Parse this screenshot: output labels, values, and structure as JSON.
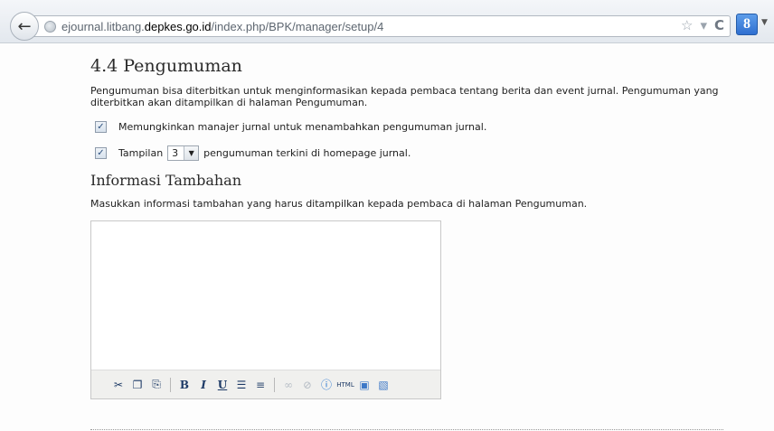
{
  "browser": {
    "url_prefix": "ejournal.litbang.",
    "url_domain": "depkes.go.id",
    "url_path": "/index.php/BPK/manager/setup/4",
    "icons": [
      "back-arrow-icon",
      "globe-icon",
      "star-icon",
      "dropdown-icon",
      "reload-icon",
      "google-plus-icon"
    ]
  },
  "section": {
    "title": "4.4 Pengumuman",
    "description": "Pengumuman bisa diterbitkan untuk menginformasikan kepada pembaca tentang berita dan event jurnal. Pengumuman yang diterbitkan akan ditampilkan di halaman Pengumuman."
  },
  "options": {
    "enable_label": "Memungkinkan manajer jurnal untuk menambahkan pengumuman jurnal.",
    "display_prefix": "Tampilan",
    "display_count": "3",
    "display_suffix": "pengumuman terkini di homepage jurnal."
  },
  "additional": {
    "title": "Informasi Tambahan",
    "description": "Masukkan informasi tambahan yang harus ditampilkan kepada pembaca di halaman Pengumuman."
  },
  "editor": {
    "toolbar": [
      "cut-icon",
      "copy-icon",
      "paste-icon",
      "bold-icon",
      "italic-icon",
      "underline-icon",
      "bullet-list-icon",
      "numbered-list-icon",
      "link-icon",
      "unlink-icon",
      "help-icon",
      "html-icon",
      "fullscreen-icon",
      "image-icon"
    ]
  }
}
